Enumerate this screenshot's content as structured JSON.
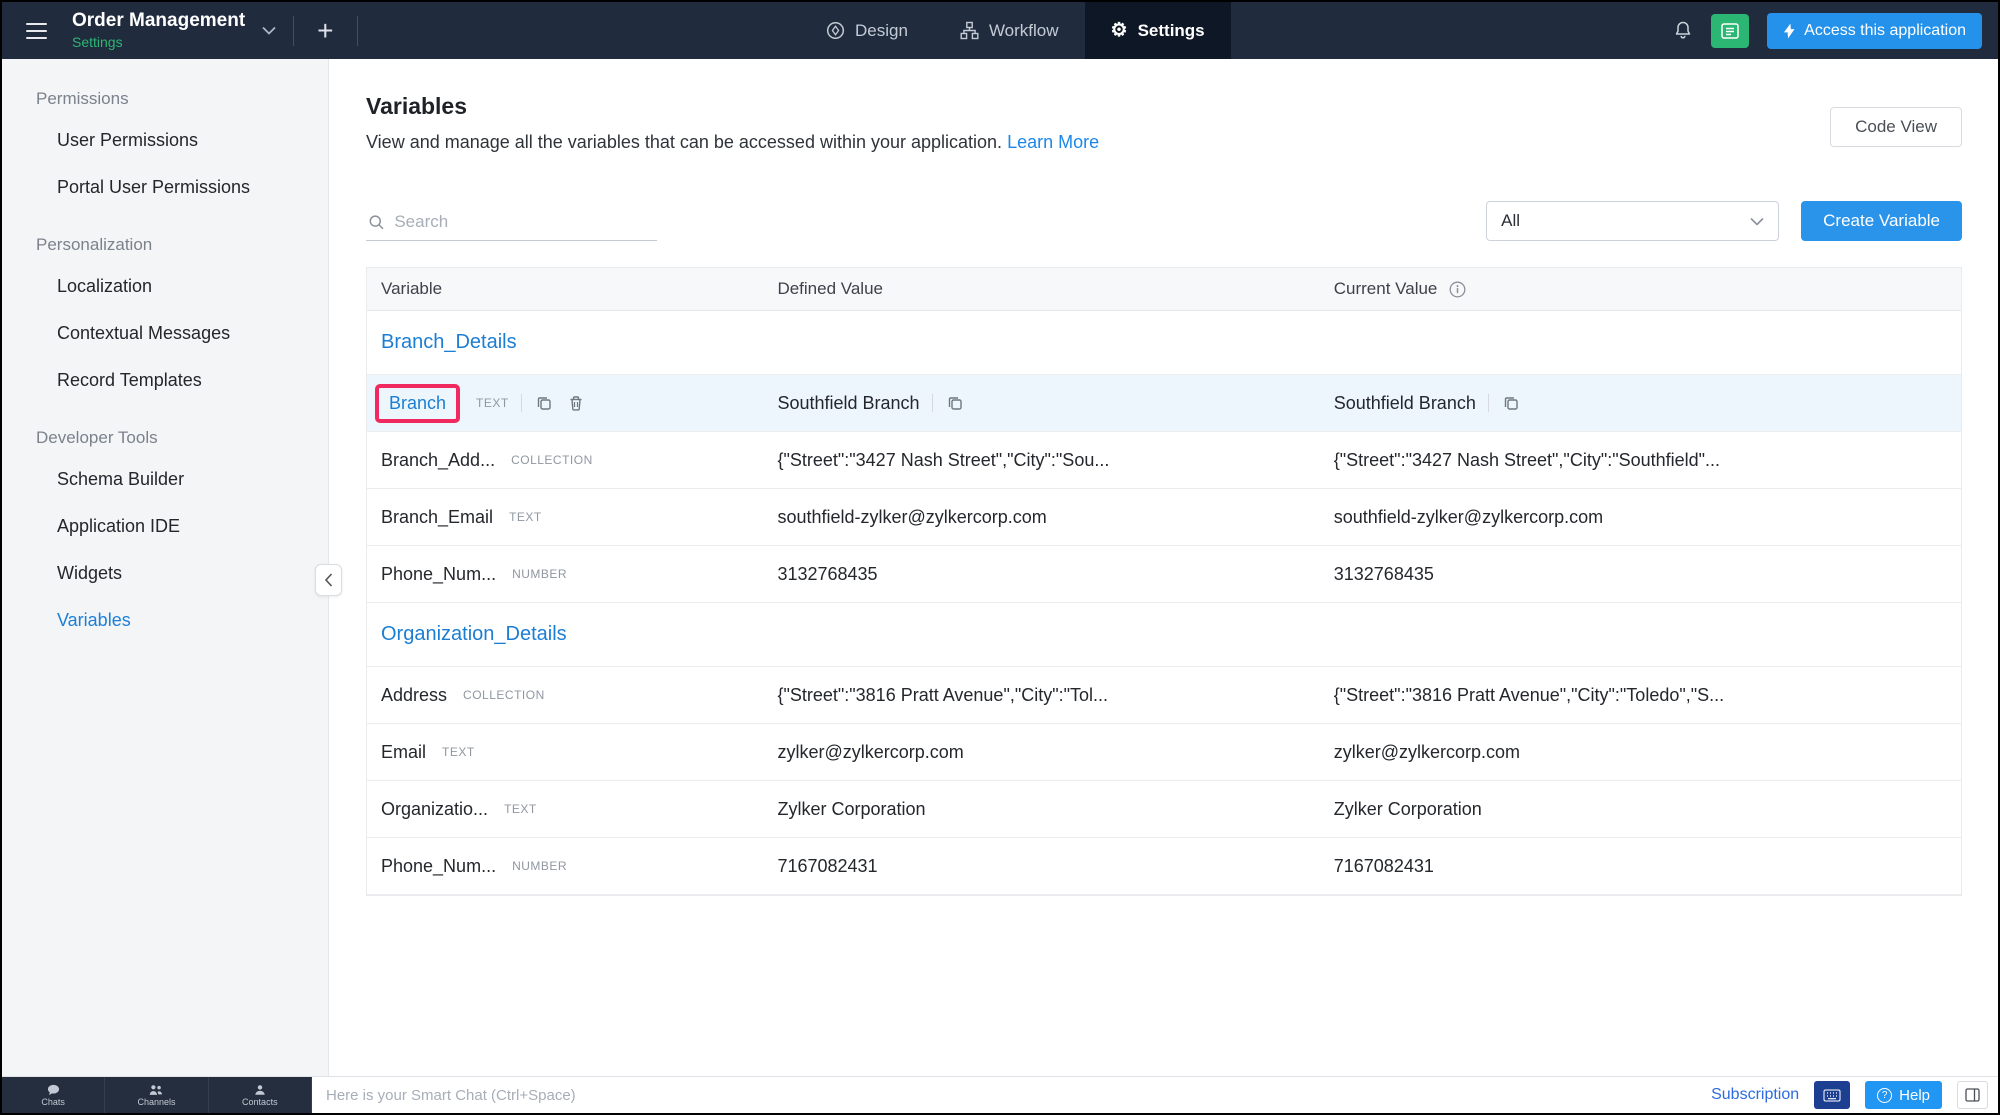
{
  "colors": {
    "topbar_bg": "#202b3d",
    "brand_green": "#2bb673",
    "accent_blue": "#2492ea",
    "link_blue": "#1c7ed3",
    "annotation_red": "#f0295f",
    "highlight_row_bg": "#edf6fd"
  },
  "topbar": {
    "app_title": "Order Management",
    "app_subtitle": "Settings",
    "nav": [
      {
        "label": "Design"
      },
      {
        "label": "Workflow"
      },
      {
        "label": "Settings"
      }
    ],
    "access_button_label": "Access this application"
  },
  "sidebar": {
    "active_item": "Variables",
    "sections": [
      {
        "heading": "Permissions",
        "items": [
          {
            "label": "User Permissions"
          },
          {
            "label": "Portal User Permissions"
          }
        ]
      },
      {
        "heading": "Personalization",
        "items": [
          {
            "label": "Localization"
          },
          {
            "label": "Contextual Messages"
          },
          {
            "label": "Record Templates"
          }
        ]
      },
      {
        "heading": "Developer Tools",
        "items": [
          {
            "label": "Schema Builder"
          },
          {
            "label": "Application IDE"
          },
          {
            "label": "Widgets"
          },
          {
            "label": "Variables"
          }
        ]
      }
    ]
  },
  "main": {
    "title": "Variables",
    "description": "View and manage all the variables that can be accessed within your application.",
    "learn_more_label": "Learn More",
    "code_view_label": "Code View",
    "search_placeholder": "Search",
    "filter_selected": "All",
    "create_button_label": "Create Variable",
    "table": {
      "columns": [
        "Variable",
        "Defined Value",
        "Current Value"
      ],
      "groups": [
        {
          "name": "Branch_Details",
          "rows": [
            {
              "name": "Branch",
              "type": "TEXT",
              "defined": "Southfield Branch",
              "current": "Southfield Branch",
              "highlighted": true,
              "annotated": true,
              "actions": true,
              "value_copy": true
            },
            {
              "name": "Branch_Add...",
              "type": "COLLECTION",
              "defined": "{\"Street\":\"3427 Nash Street\",\"City\":\"Sou...",
              "current": "{\"Street\":\"3427 Nash Street\",\"City\":\"Southfield\"..."
            },
            {
              "name": "Branch_Email",
              "type": "TEXT",
              "defined": "southfield-zylker@zylkercorp.com",
              "current": "southfield-zylker@zylkercorp.com"
            },
            {
              "name": "Phone_Num...",
              "type": "NUMBER",
              "defined": "3132768435",
              "current": "3132768435"
            }
          ]
        },
        {
          "name": "Organization_Details",
          "rows": [
            {
              "name": "Address",
              "type": "COLLECTION",
              "defined": "{\"Street\":\"3816 Pratt Avenue\",\"City\":\"Tol...",
              "current": "{\"Street\":\"3816 Pratt Avenue\",\"City\":\"Toledo\",\"S..."
            },
            {
              "name": "Email",
              "type": "TEXT",
              "defined": "zylker@zylkercorp.com",
              "current": "zylker@zylkercorp.com"
            },
            {
              "name": "Organizatio...",
              "type": "TEXT",
              "defined": "Zylker Corporation",
              "current": "Zylker Corporation"
            },
            {
              "name": "Phone_Num...",
              "type": "NUMBER",
              "defined": "7167082431",
              "current": "7167082431"
            }
          ]
        }
      ]
    }
  },
  "footer": {
    "dock_items": [
      {
        "label": "Chats"
      },
      {
        "label": "Channels"
      },
      {
        "label": "Contacts"
      }
    ],
    "smart_chat_placeholder": "Here is your Smart Chat (Ctrl+Space)",
    "subscription_label": "Subscription",
    "help_label": "Help"
  }
}
